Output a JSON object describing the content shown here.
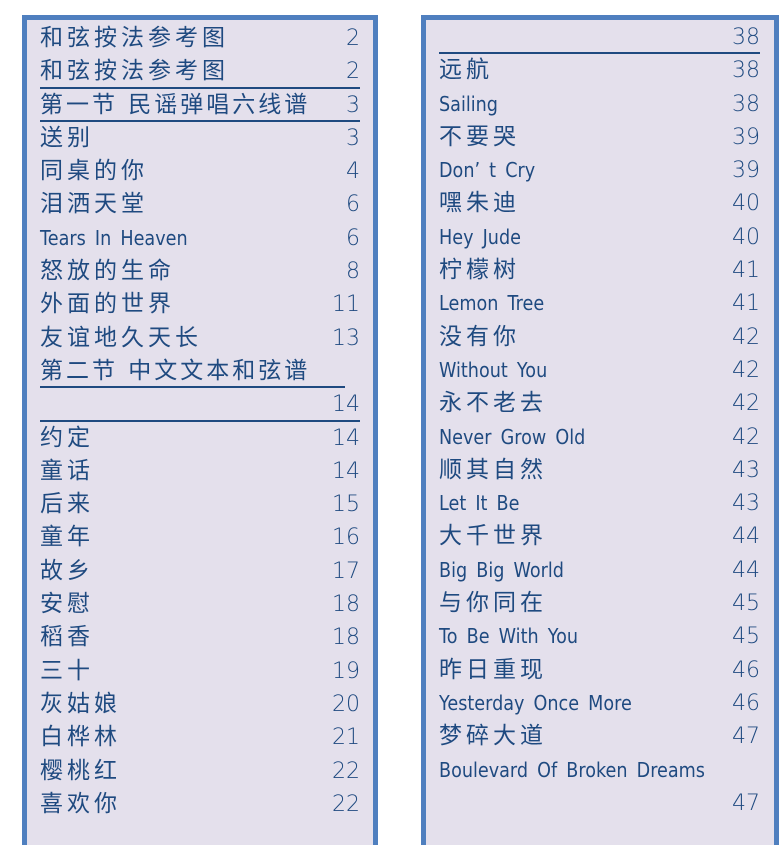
{
  "left_column": {
    "rows": [
      {
        "title": "和弦按法参考图",
        "page": "2",
        "kind": "cn"
      },
      {
        "title": "和弦按法参考图",
        "page": "2",
        "kind": "cn"
      },
      {
        "title": "第一节  民谣弹唱六线谱",
        "page": "3",
        "kind": "heading"
      },
      {
        "title": "送别",
        "page": "3",
        "kind": "cn"
      },
      {
        "title": "同桌的你",
        "page": "4",
        "kind": "cn"
      },
      {
        "title": "泪洒天堂",
        "page": "6",
        "kind": "cn"
      },
      {
        "title": "Tears In Heaven",
        "page": "6",
        "kind": "en"
      },
      {
        "title": "怒放的生命",
        "page": "8",
        "kind": "cn"
      },
      {
        "title": "外面的世界",
        "page": "11",
        "kind": "cn"
      },
      {
        "title": "友谊地久天长",
        "page": "13",
        "kind": "cn"
      },
      {
        "title": "第二节  中文文本和弦谱",
        "page": "",
        "kind": "heading"
      },
      {
        "title": "",
        "page": "14",
        "kind": "cn"
      },
      {
        "title": "约定",
        "page": "14",
        "kind": "cn"
      },
      {
        "title": "童话",
        "page": "14",
        "kind": "cn"
      },
      {
        "title": "后来",
        "page": "15",
        "kind": "cn"
      },
      {
        "title": "童年",
        "page": "16",
        "kind": "cn"
      },
      {
        "title": "故乡",
        "page": "17",
        "kind": "cn"
      },
      {
        "title": "安慰",
        "page": "18",
        "kind": "cn"
      },
      {
        "title": "稻香",
        "page": "18",
        "kind": "cn"
      },
      {
        "title": "三十",
        "page": "19",
        "kind": "cn"
      },
      {
        "title": "灰姑娘",
        "page": "20",
        "kind": "cn"
      },
      {
        "title": "白桦林",
        "page": "21",
        "kind": "cn"
      },
      {
        "title": "樱桃红",
        "page": "22",
        "kind": "cn"
      },
      {
        "title": "喜欢你",
        "page": "22",
        "kind": "cn"
      }
    ]
  },
  "right_column": {
    "rows": [
      {
        "title": "",
        "page": "38",
        "kind": "cn"
      },
      {
        "title": "远航",
        "page": "38",
        "kind": "cn"
      },
      {
        "title": "Sailing",
        "page": "38",
        "kind": "en"
      },
      {
        "title": "不要哭",
        "page": "39",
        "kind": "cn"
      },
      {
        "title": "Don’ t Cry",
        "page": "39",
        "kind": "en"
      },
      {
        "title": "嘿朱迪",
        "page": "40",
        "kind": "cn"
      },
      {
        "title": "Hey Jude",
        "page": "40",
        "kind": "en"
      },
      {
        "title": "柠檬树",
        "page": "41",
        "kind": "cn"
      },
      {
        "title": "Lemon Tree",
        "page": "41",
        "kind": "en"
      },
      {
        "title": "没有你",
        "page": "42",
        "kind": "cn"
      },
      {
        "title": "Without You",
        "page": "42",
        "kind": "en"
      },
      {
        "title": "永不老去",
        "page": "42",
        "kind": "cn"
      },
      {
        "title": "Never Grow Old",
        "page": "42",
        "kind": "en"
      },
      {
        "title": "顺其自然",
        "page": "43",
        "kind": "cn"
      },
      {
        "title": "Let It Be",
        "page": "43",
        "kind": "en"
      },
      {
        "title": "大千世界",
        "page": "44",
        "kind": "cn"
      },
      {
        "title": "Big Big World",
        "page": "44",
        "kind": "en"
      },
      {
        "title": "与你同在",
        "page": "45",
        "kind": "cn"
      },
      {
        "title": "To Be With You",
        "page": "45",
        "kind": "en"
      },
      {
        "title": "昨日重现",
        "page": "46",
        "kind": "cn"
      },
      {
        "title": "Yesterday Once More",
        "page": "46",
        "kind": "en"
      },
      {
        "title": "梦碎大道",
        "page": "47",
        "kind": "cn"
      },
      {
        "title": "Boulevard Of Broken Dreams",
        "page": "",
        "kind": "en"
      },
      {
        "title": "",
        "page": "47",
        "kind": "cn"
      }
    ]
  },
  "colors": {
    "border": "#4f7fbf",
    "background": "#e4e0ec",
    "text": "#1f4a80"
  }
}
